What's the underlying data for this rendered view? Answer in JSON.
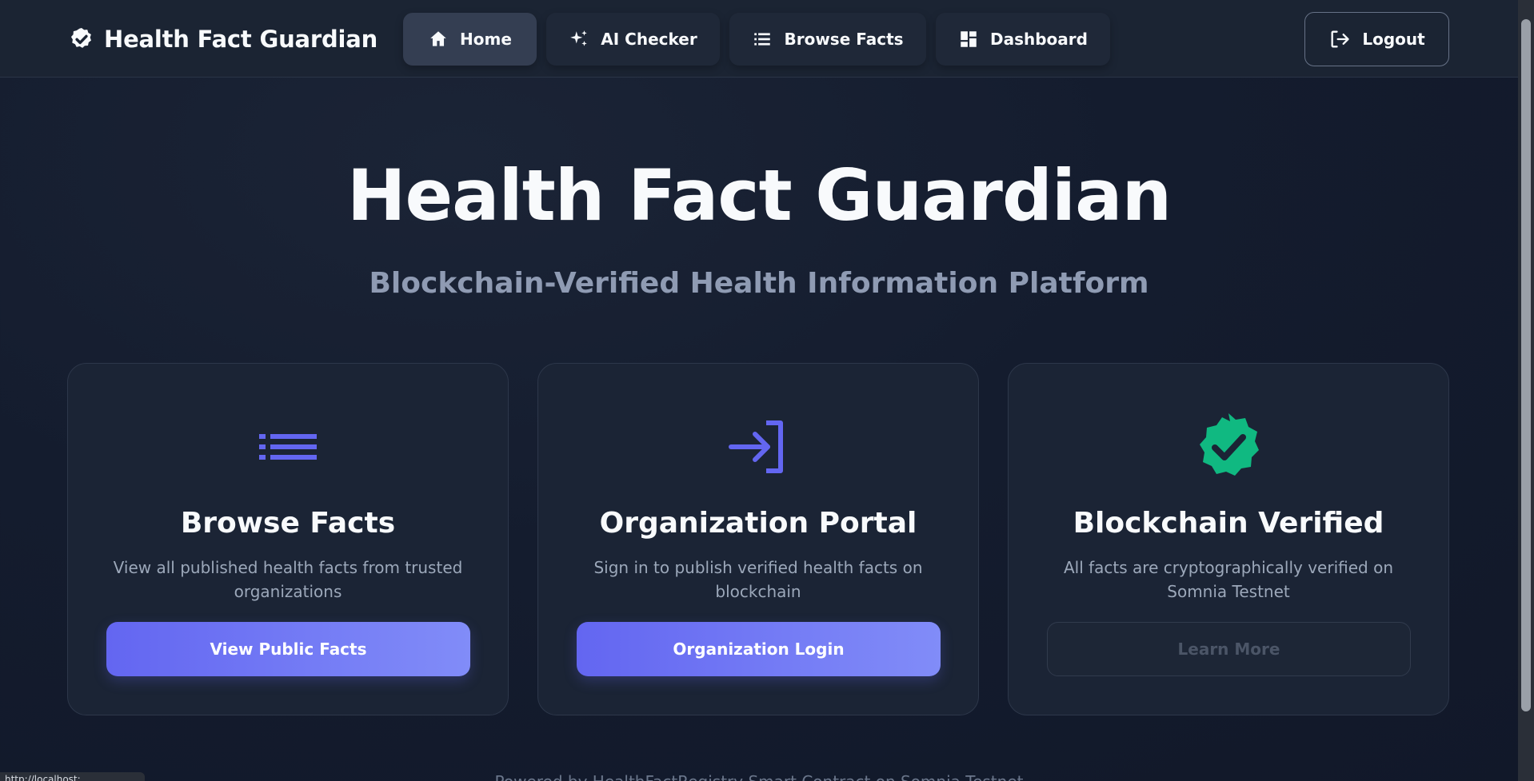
{
  "app": {
    "brand_name": "Health Fact Guardian",
    "brand_icon": "verified-badge-icon"
  },
  "nav": {
    "items": [
      {
        "label": "Home",
        "icon": "home-icon",
        "active": true
      },
      {
        "label": "AI Checker",
        "icon": "sparkles-icon",
        "active": false
      },
      {
        "label": "Browse Facts",
        "icon": "list-icon",
        "active": false
      },
      {
        "label": "Dashboard",
        "icon": "dashboard-icon",
        "active": false
      }
    ],
    "logout_label": "Logout"
  },
  "hero": {
    "title": "Health Fact Guardian",
    "subtitle": "Blockchain-Verified Health Information Platform"
  },
  "cards": [
    {
      "icon": "list-icon",
      "title": "Browse Facts",
      "description": "View all published health facts from trusted organizations",
      "button_label": "View Public Facts"
    },
    {
      "icon": "login-icon",
      "title": "Organization Portal",
      "description": "Sign in to publish verified health facts on blockchain",
      "button_label": "Organization Login"
    },
    {
      "icon": "verified-badge-icon",
      "title": "Blockchain Verified",
      "description": "All facts are cryptographically verified on Somnia Testnet",
      "button_label": "Learn More"
    }
  ],
  "footer": {
    "text": "Powered by HealthFactRegistry Smart Contract on Somnia Testnet"
  },
  "status_bar": {
    "url": "http://localhost:..."
  },
  "colors": {
    "accent": "#6366f1",
    "accent_light": "#818cf8",
    "success": "#10b981",
    "background": "#141c2e",
    "card": "#1b2435"
  }
}
